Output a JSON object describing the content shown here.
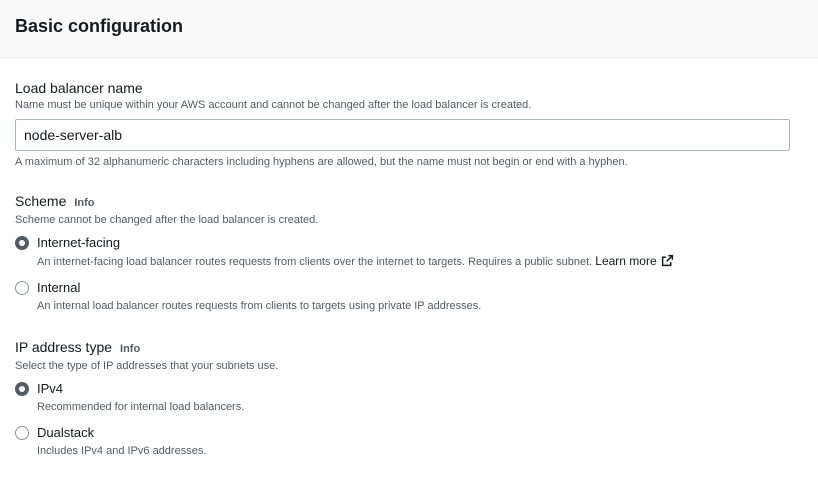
{
  "panel": {
    "title": "Basic configuration"
  },
  "lb_name": {
    "label": "Load balancer name",
    "description": "Name must be unique within your AWS account and cannot be changed after the load balancer is created.",
    "value": "node-server-alb",
    "constraint": "A maximum of 32 alphanumeric characters including hyphens are allowed, but the name must not begin or end with a hyphen."
  },
  "scheme": {
    "label": "Scheme",
    "info": "Info",
    "description": "Scheme cannot be changed after the load balancer is created.",
    "options": [
      {
        "label": "Internet-facing",
        "description": "An internet-facing load balancer routes requests from clients over the internet to targets. Requires a public subnet.",
        "link": "Learn more",
        "link_icon": "external-link-icon",
        "selected": true
      },
      {
        "label": "Internal",
        "description": "An internal load balancer routes requests from clients to targets using private IP addresses.",
        "selected": false
      }
    ]
  },
  "ip_type": {
    "label": "IP address type",
    "info": "Info",
    "description": "Select the type of IP addresses that your subnets use.",
    "options": [
      {
        "label": "IPv4",
        "description": "Recommended for internal load balancers.",
        "selected": true
      },
      {
        "label": "Dualstack",
        "description": "Includes IPv4 and IPv6 addresses.",
        "selected": false
      }
    ]
  }
}
